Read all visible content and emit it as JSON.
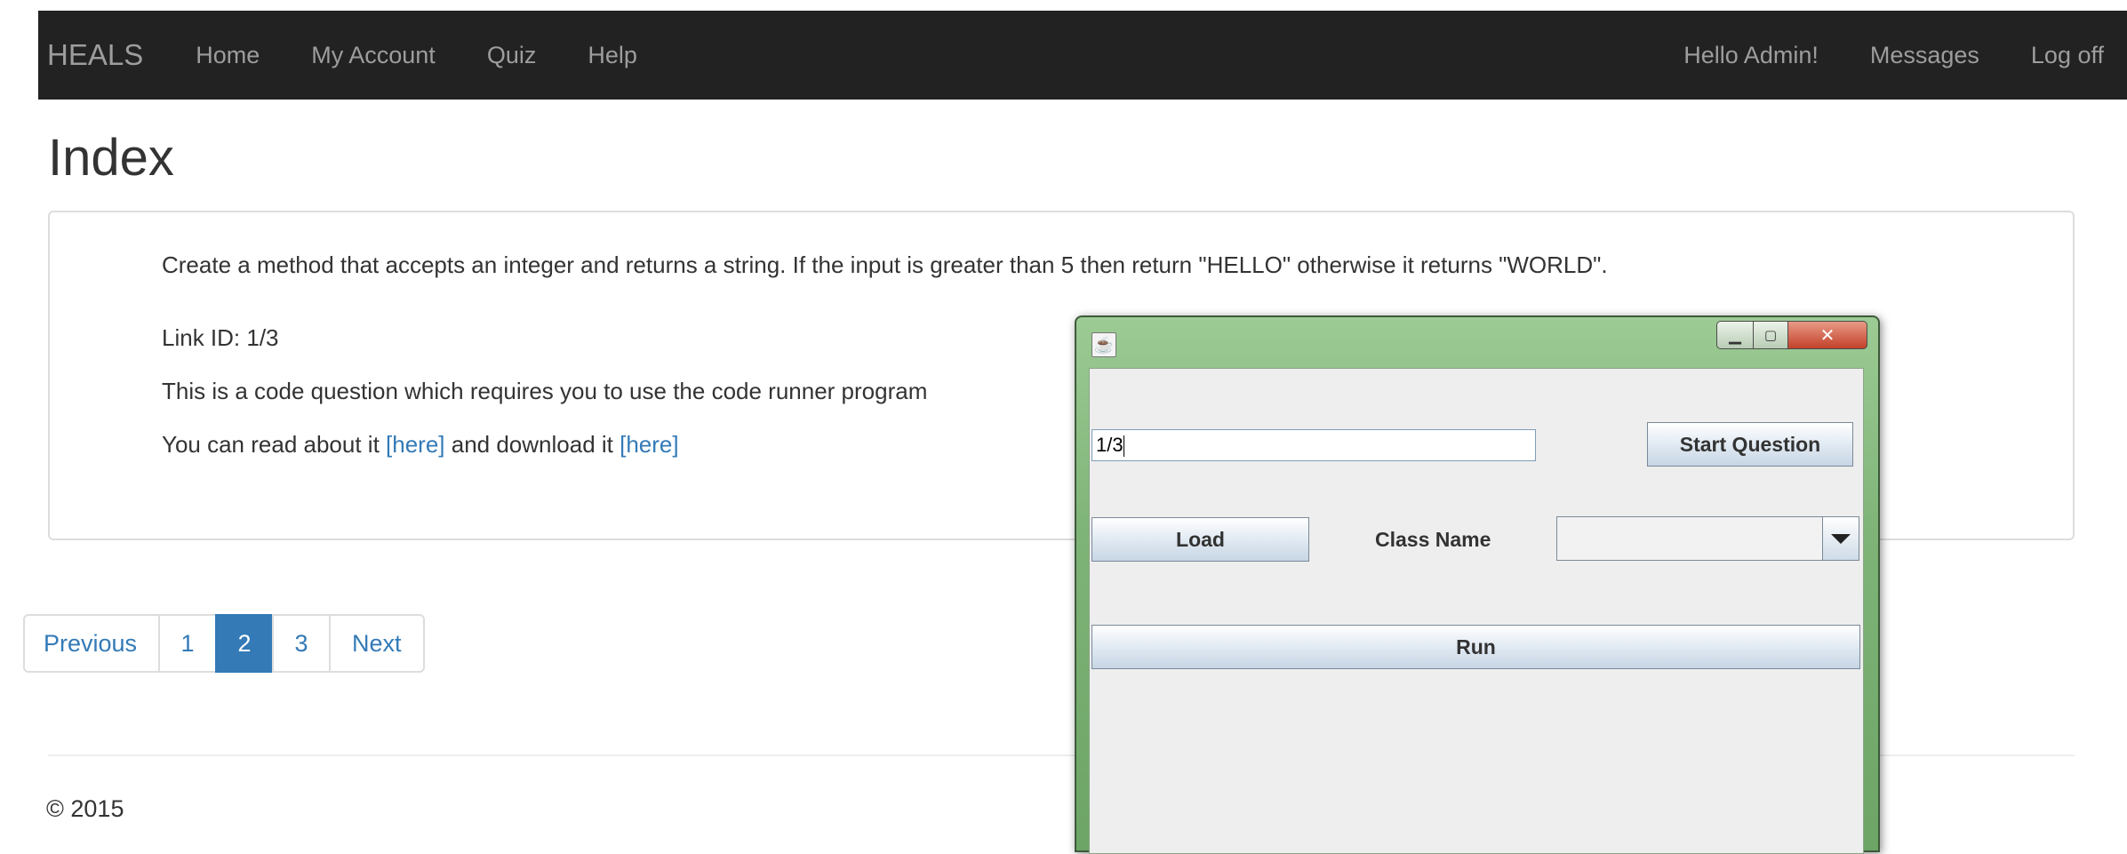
{
  "navbar": {
    "brand": "HEALS",
    "left_links": [
      "Home",
      "My Account",
      "Quiz",
      "Help"
    ],
    "right_links": [
      "Hello Admin!",
      "Messages",
      "Log off"
    ]
  },
  "page": {
    "title": "Index",
    "question": "Create a method that accepts an integer and returns a string. If the input is greater than 5 then return \"HELLO\" otherwise it returns \"WORLD\".",
    "link_id": "Link ID: 1/3",
    "code_note": "This is a code question which requires you to use the code runner program",
    "read_prefix": "You can read about it ",
    "read_link": "[here]",
    "download_middle": " and download it ",
    "download_link": "[here]"
  },
  "pagination": {
    "previous": "Previous",
    "pages": [
      "1",
      "2",
      "3"
    ],
    "active_page": "2",
    "next": "Next"
  },
  "footer": {
    "copyright": "© 2015"
  },
  "code_runner": {
    "link_field_value": "1/3",
    "start_button": "Start Question",
    "load_button": "Load",
    "class_name_label": "Class Name",
    "class_name_value": "",
    "run_button": "Run"
  },
  "colors": {
    "navbar_bg": "#222222",
    "link": "#337ab7",
    "active_page": "#337ab7",
    "window_frame": "#7fb478",
    "close_button": "#c3412a"
  }
}
